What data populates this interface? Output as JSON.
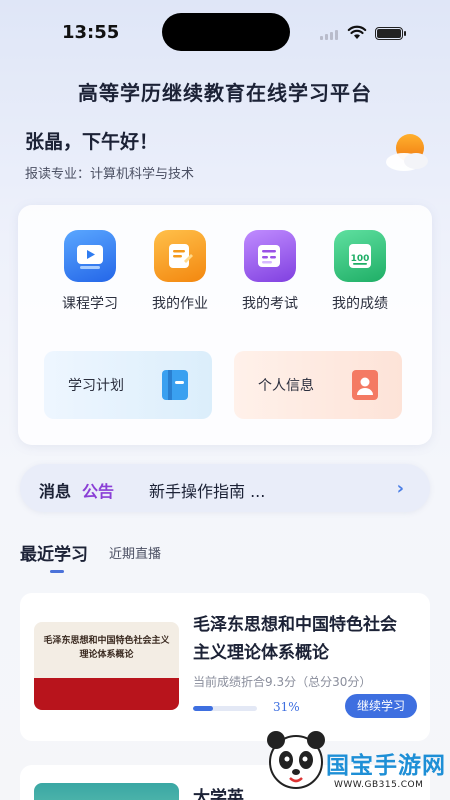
{
  "status_bar": {
    "time": "13:55"
  },
  "app_title": "高等学历继续教育在线学习平台",
  "user": {
    "greeting": "张晶，下午好！",
    "major": "报读专业：计算机科学与技术"
  },
  "quick_menu": [
    {
      "label": "课程学习",
      "icon": "video-icon",
      "color": "#2f7cf0"
    },
    {
      "label": "我的作业",
      "icon": "homework-icon",
      "color": "#f59a1b"
    },
    {
      "label": "我的考试",
      "icon": "exam-icon",
      "color": "#9a52e6"
    },
    {
      "label": "我的成绩",
      "icon": "score-icon",
      "color": "#2fbf7a"
    }
  ],
  "shortcuts": {
    "plan_label": "学习计划",
    "profile_label": "个人信息"
  },
  "notice": {
    "prefix": "消息",
    "highlight": "公告",
    "text": "新手操作指南 ..."
  },
  "tabs": {
    "recent": "最近学习",
    "live": "近期直播"
  },
  "courses": [
    {
      "title": "毛泽东思想和中国特色社会主义理论体系概论",
      "thumb_title": "毛泽东思想和中国特色社会主义理论体系概论",
      "score": "当前成绩折合9.3分（总分30分）",
      "progress": 0.31,
      "progress_text": "31%",
      "action": "继续学习"
    },
    {
      "title": "大学英"
    }
  ],
  "watermark": {
    "text": "国宝手游网",
    "url": "WWW.GB315.COM"
  }
}
